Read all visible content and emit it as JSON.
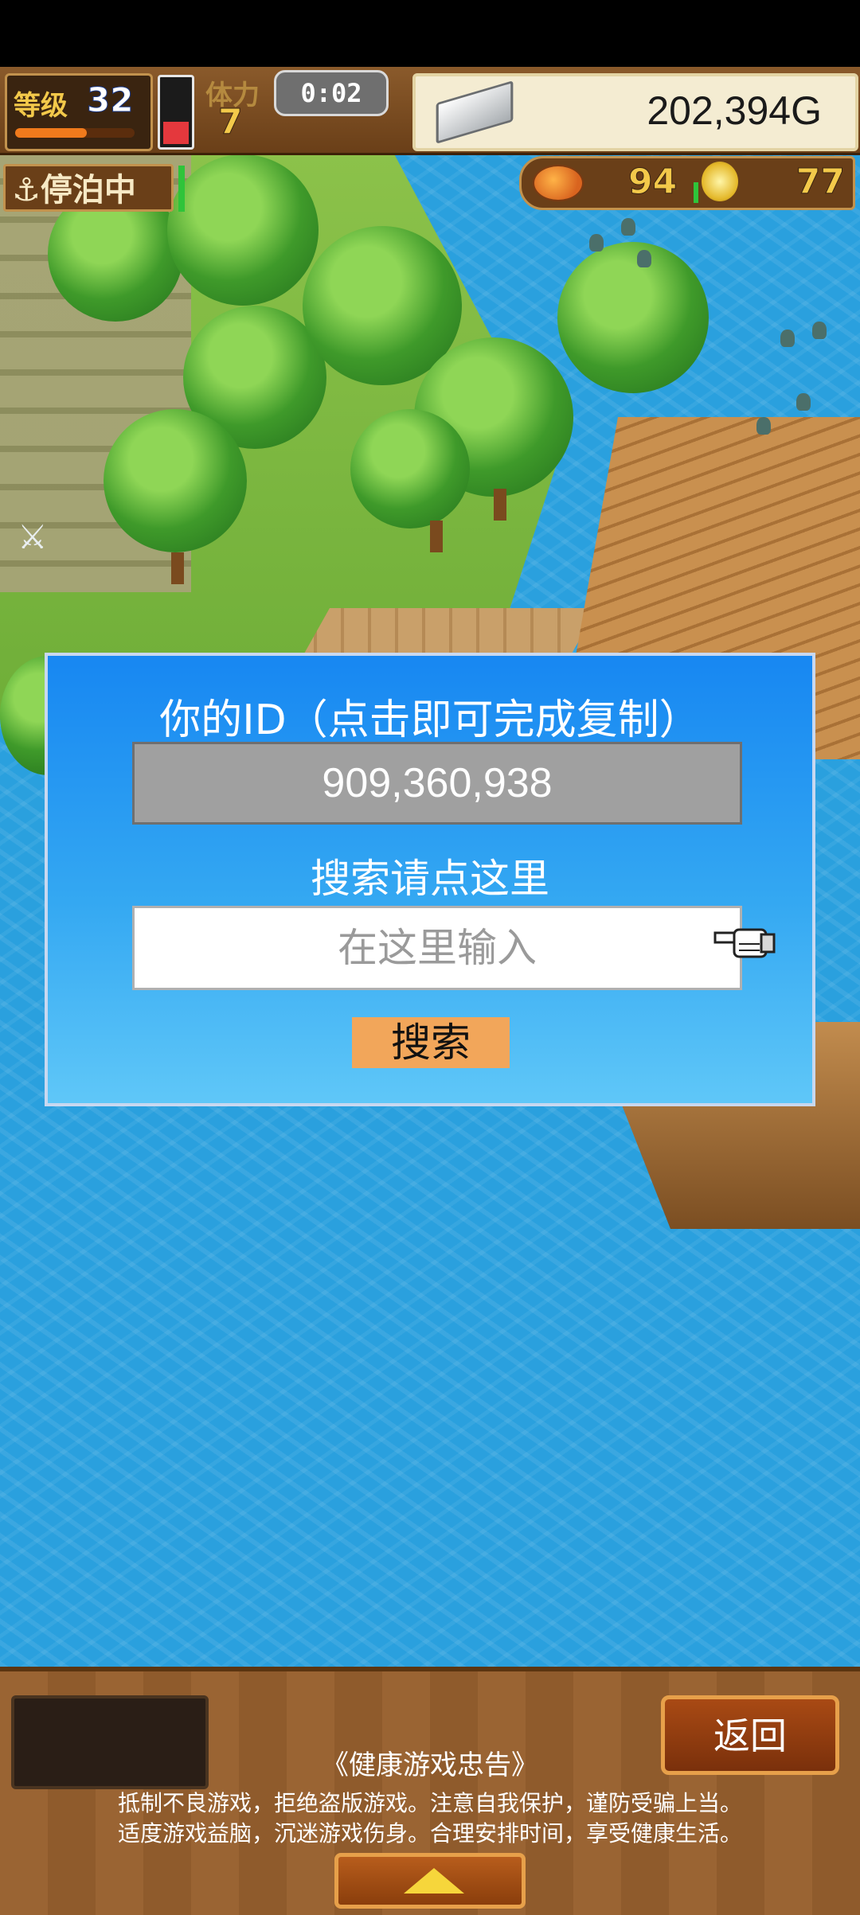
{
  "hud": {
    "level_label": "等级",
    "level_value": "32",
    "level_progress_percent": 60,
    "stamina_label": "体力",
    "stamina_value": "7",
    "stamina_fill_percent": 35,
    "timer": "0:02",
    "gold": "202,394G",
    "status": "停泊中",
    "food": "94",
    "coins": "77",
    "colors": {
      "hud_wood": "#6a3f18",
      "hud_gold_text": "#f3c94a",
      "stamina_red": "#e4383d"
    },
    "icons": [
      "anchor-icon",
      "silver-bar-icon",
      "food-icon",
      "coin-icon"
    ]
  },
  "dialog": {
    "title": "你的ID（点击即可完成复制）",
    "id_value": "909,360,938",
    "search_hint": "搜索请点这里",
    "search_placeholder": "在这里输入",
    "search_button": "搜索",
    "colors": {
      "top": "#1787f2",
      "bottom": "#5fc7f8",
      "button": "#f2a65a"
    },
    "icons": [
      "pointing-hand-icon"
    ]
  },
  "bottom": {
    "back_button": "返回",
    "notice_title": "《健康游戏忠告》",
    "notice_line1": "抵制不良游戏，拒绝盗版游戏。注意自我保护，谨防受骗上当。",
    "notice_line2": "适度游戏益脑，沉迷游戏伤身。合理安排时间，享受健康生活。",
    "icons": [
      "up-arrow-icon"
    ]
  }
}
